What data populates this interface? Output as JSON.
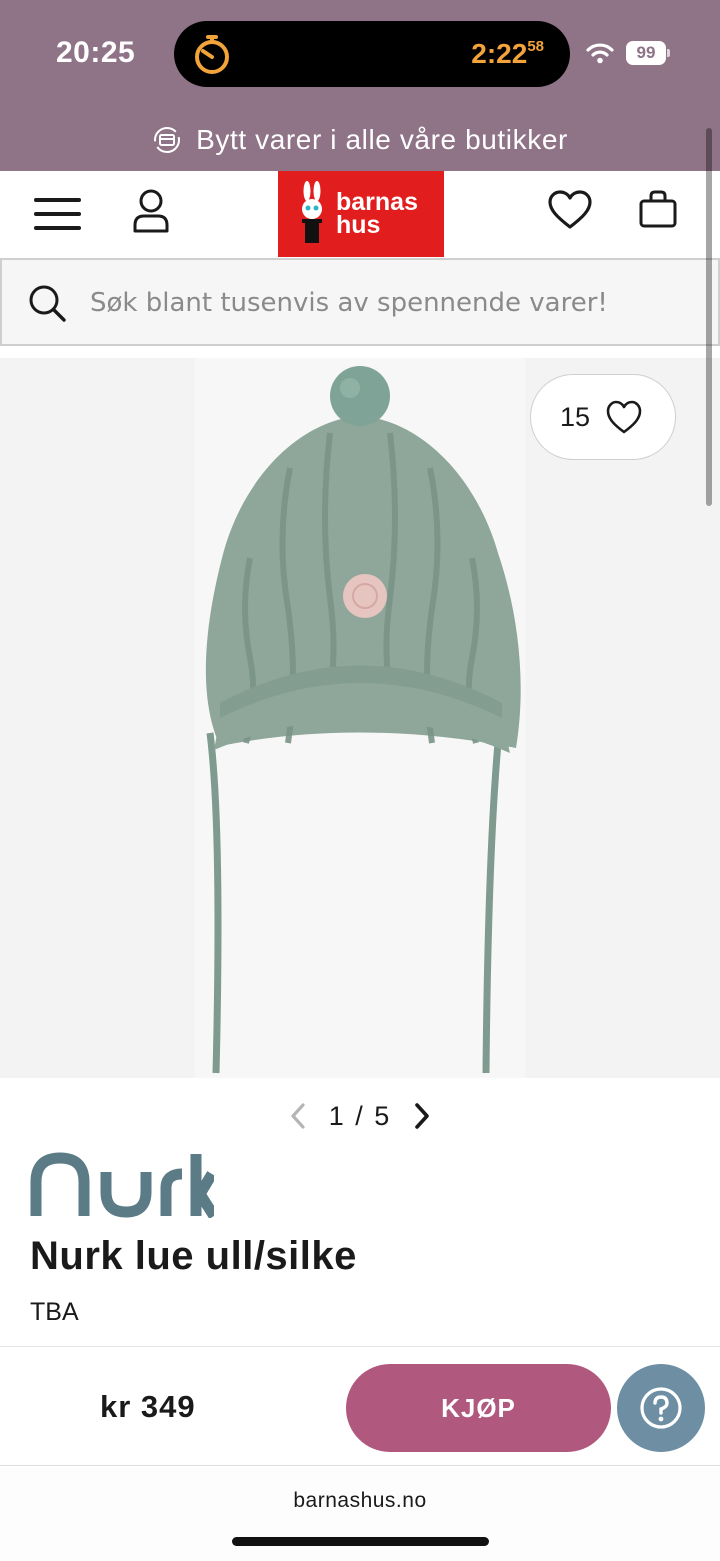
{
  "status_bar": {
    "time": "20:25",
    "timer_hm": "2:22",
    "timer_s": "58",
    "battery": "99"
  },
  "promo": {
    "text": "Bytt varer i alle våre butikker",
    "icon": "exchange-icon"
  },
  "header": {
    "logo_line1": "barnas",
    "logo_line2": "hus",
    "icons": [
      "menu-icon",
      "account-icon",
      "heart-icon",
      "bag-icon"
    ],
    "logo_color": "#e11d1d"
  },
  "search": {
    "placeholder": "Søk blant tusenvis av spennende varer!"
  },
  "gallery": {
    "wishlist_count": "15",
    "pager_current": "1",
    "pager_total": "5",
    "pager_separator": "/"
  },
  "product": {
    "brand": "nurk",
    "title": "Nurk lue ull/silke",
    "subtitle": "TBA",
    "price": "kr 349",
    "buy_label": "KJØP"
  },
  "browser": {
    "url": "barnashus.no"
  },
  "colors": {
    "header_purple": "#8f7387",
    "buy_button": "#b0587d",
    "help_button": "#6e8ea4",
    "brand_teal": "#5b7b86"
  }
}
